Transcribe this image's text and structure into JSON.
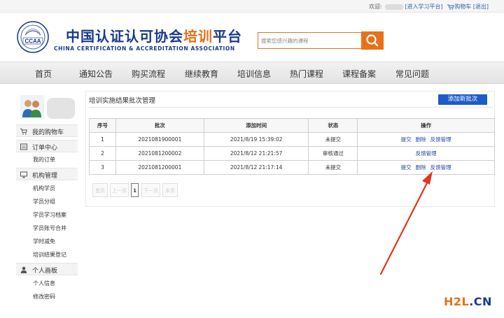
{
  "topbar": {
    "welcome": "欢迎:",
    "enter_study": "[进入学习平台]",
    "cart": "购物车",
    "logout": "[退出]"
  },
  "header": {
    "brand_cn_main": "中国认证认可协会",
    "brand_cn_highlight": "培训",
    "brand_cn_tail": "平台",
    "brand_en": "CHINA CERTIFICATION & ACCREDITATION ASSOCIATION",
    "logo_text": "CCAA",
    "search_placeholder": "搜索您感兴趣的课程"
  },
  "nav": [
    "首页",
    "通知公告",
    "购买流程",
    "继续教育",
    "培训信息",
    "热门课程",
    "课程备案",
    "常见问题"
  ],
  "sidebar": {
    "sections": [
      {
        "label": "我的购物车",
        "icon": "cart-icon",
        "items": []
      },
      {
        "label": "订单中心",
        "icon": "order-icon",
        "items": [
          "我的订单"
        ]
      },
      {
        "label": "机构管理",
        "icon": "monitor-icon",
        "items": [
          "机构学员",
          "学员分组",
          "学员学习档案",
          "学员账号合并",
          "学时减免",
          "培训结果登记"
        ]
      },
      {
        "label": "个人画板",
        "icon": "user-icon",
        "items": [
          "个人信息",
          "修改密码"
        ]
      }
    ]
  },
  "main": {
    "title": "培训实施结果批次管理",
    "add_button": "添加新批次",
    "columns": [
      "序号",
      "批次",
      "添加时间",
      "状态",
      "操作"
    ],
    "rows": [
      {
        "no": "1",
        "batch": "2021081900001",
        "time": "2021/8/19 15:39:02",
        "status": "未提交",
        "actions": [
          "提交",
          "删除",
          "反馈管理"
        ]
      },
      {
        "no": "2",
        "batch": "2021081200002",
        "time": "2021/8/12 21:21:57",
        "status": "审核通过",
        "actions": [
          "反馈管理"
        ]
      },
      {
        "no": "3",
        "batch": "2021081200001",
        "time": "2021/8/12 21:17:14",
        "status": "未提交",
        "actions": [
          "提交",
          "删除",
          "反馈管理"
        ]
      }
    ],
    "pager": [
      "首页",
      "上一页",
      "1",
      "下一页",
      "末页"
    ]
  },
  "watermark": {
    "part1": "H2L",
    "part2": ".CN"
  },
  "colors": {
    "brand_blue": "#1a3a8a",
    "accent_orange": "#e8701a",
    "button_blue": "#1e5bc6",
    "arrow_red": "#e53321"
  }
}
